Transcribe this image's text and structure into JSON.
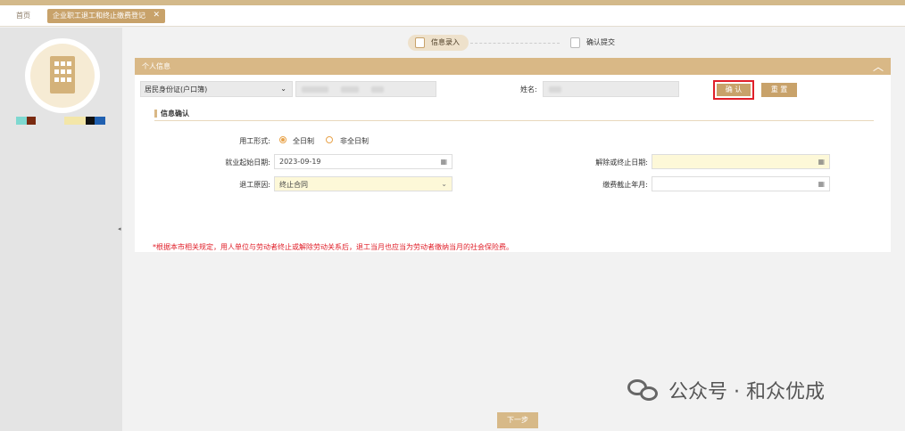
{
  "tabs": {
    "home": "首页",
    "active": "企业职工退工和终止缴费登记",
    "close": "✕"
  },
  "sidebar": {
    "colors": [
      "#7fd8d0",
      "#7a2a10",
      "#f3e6a8",
      "#4a90d0",
      "#111111",
      "#2060b0"
    ]
  },
  "steps": {
    "step1": "信息录入",
    "step2": "确认提交"
  },
  "panel": {
    "title": "个人信息",
    "toggle": "︿"
  },
  "id_type": {
    "value": "居民身份证(户口簿)",
    "chevron": "⌄"
  },
  "name_label": "姓名:",
  "buttons": {
    "confirm": "确 认",
    "reset": "重 置",
    "next": "下一步"
  },
  "section": {
    "title": "信息确认"
  },
  "employment": {
    "label": "用工形式:",
    "options": [
      {
        "label": "全日制",
        "selected": true
      },
      {
        "label": "非全日制",
        "selected": false
      }
    ]
  },
  "start_date": {
    "label": "就业起始日期:",
    "value": "2023-09-19"
  },
  "end_date": {
    "label": "解除或终止日期:",
    "value": ""
  },
  "reason": {
    "label": "退工原因:",
    "value": "终止合同"
  },
  "pay_end": {
    "label": "缴费截止年月:",
    "value": ""
  },
  "icons": {
    "calendar": "▦",
    "chevron": "⌄"
  },
  "warning": "*根据本市相关规定，用人单位与劳动者终止或解除劳动关系后，退工当月也应当为劳动者缴纳当月的社会保险费。",
  "watermark": "公众号 · 和众优成"
}
